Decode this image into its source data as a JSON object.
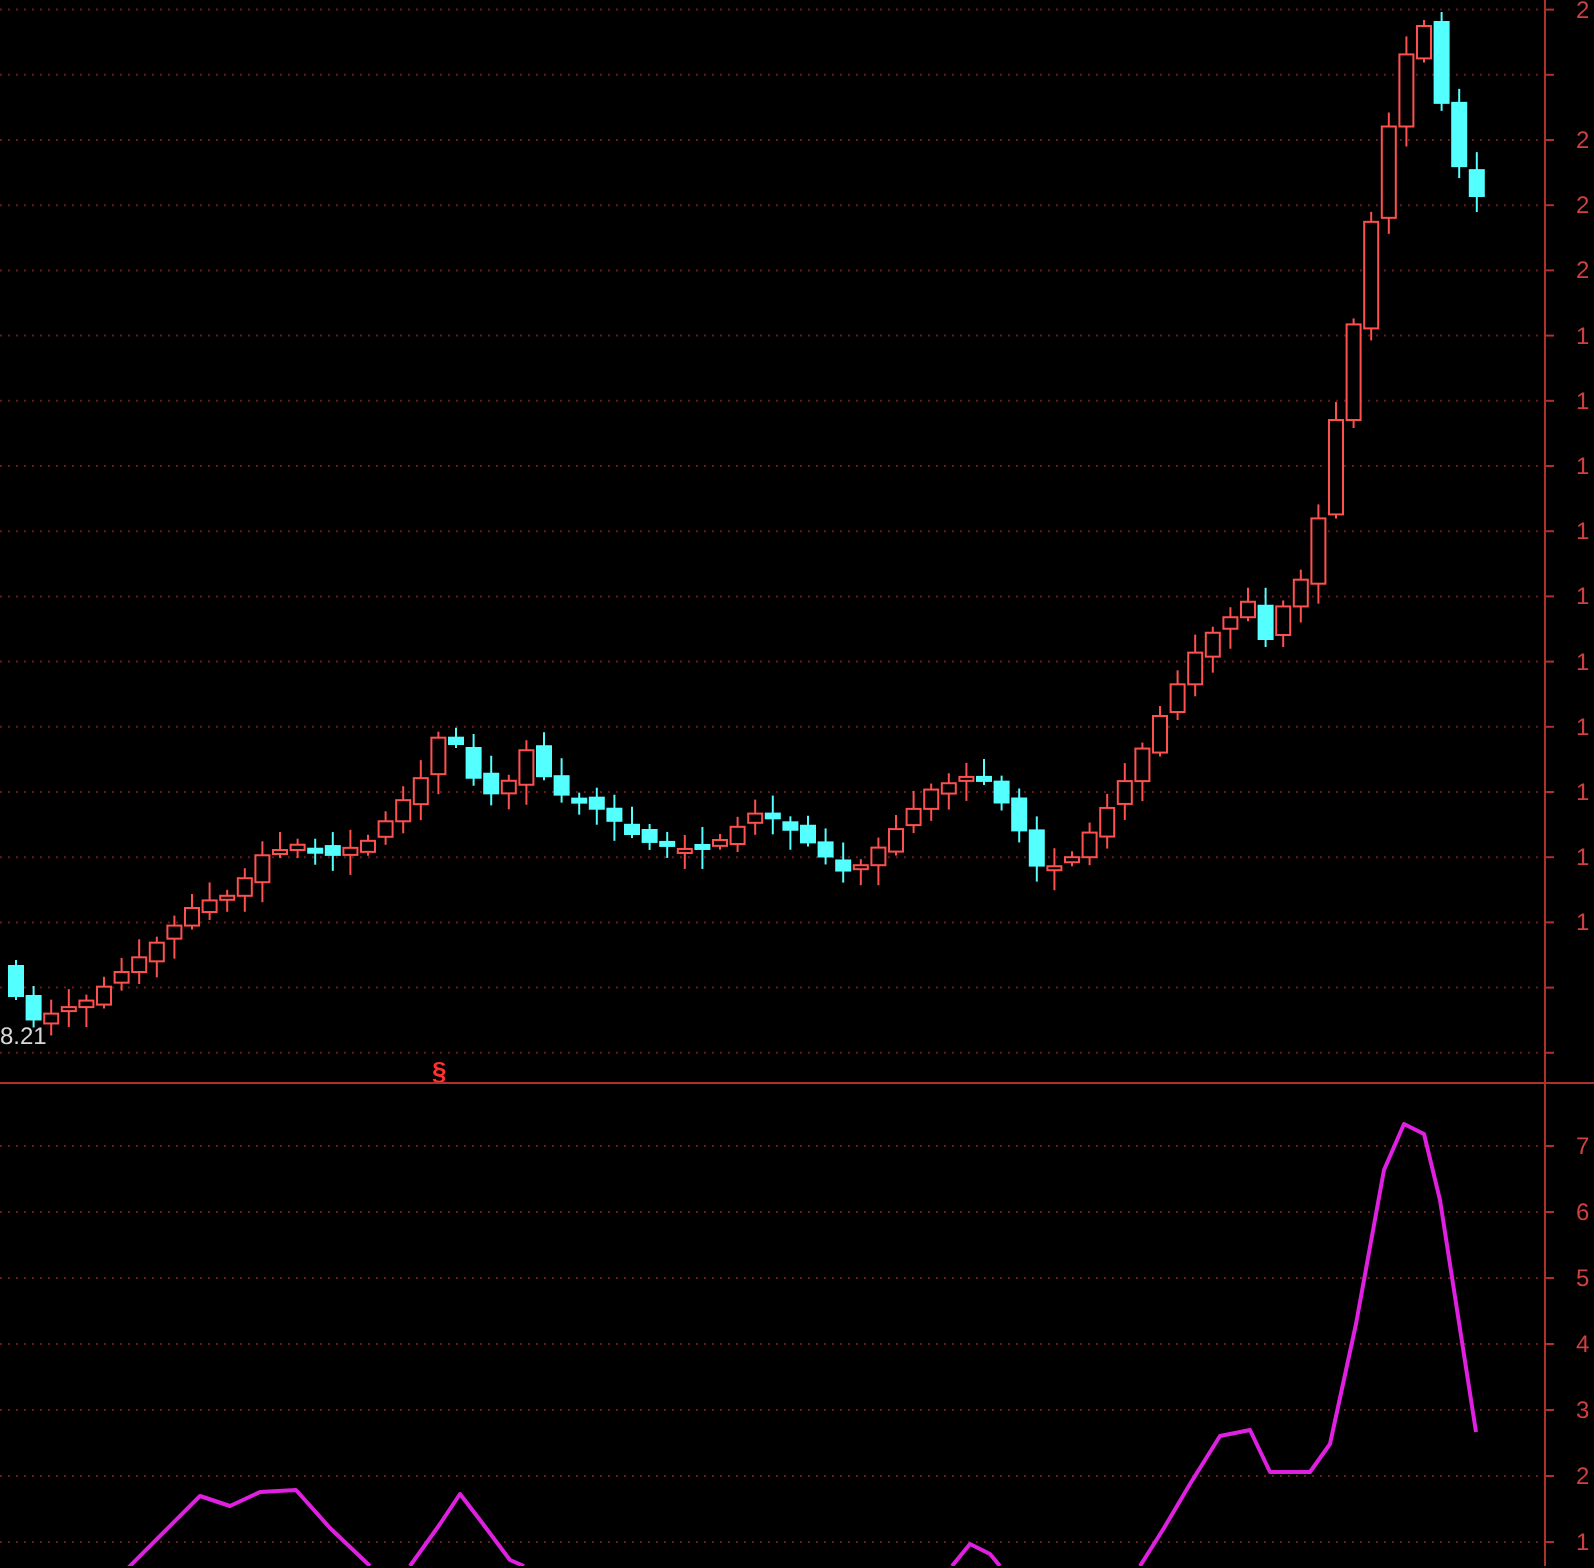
{
  "price_panel": {
    "axis_labels": [
      "2",
      "2",
      "2",
      "2",
      "1",
      "1",
      "1",
      "1",
      "1",
      "1",
      "1",
      "1",
      "1",
      "1"
    ],
    "low_label": "8.21",
    "marker": "§"
  },
  "indicator_panel": {
    "axis_labels": [
      "7",
      "6",
      "5",
      "4",
      "3",
      "2",
      "1"
    ]
  }
}
